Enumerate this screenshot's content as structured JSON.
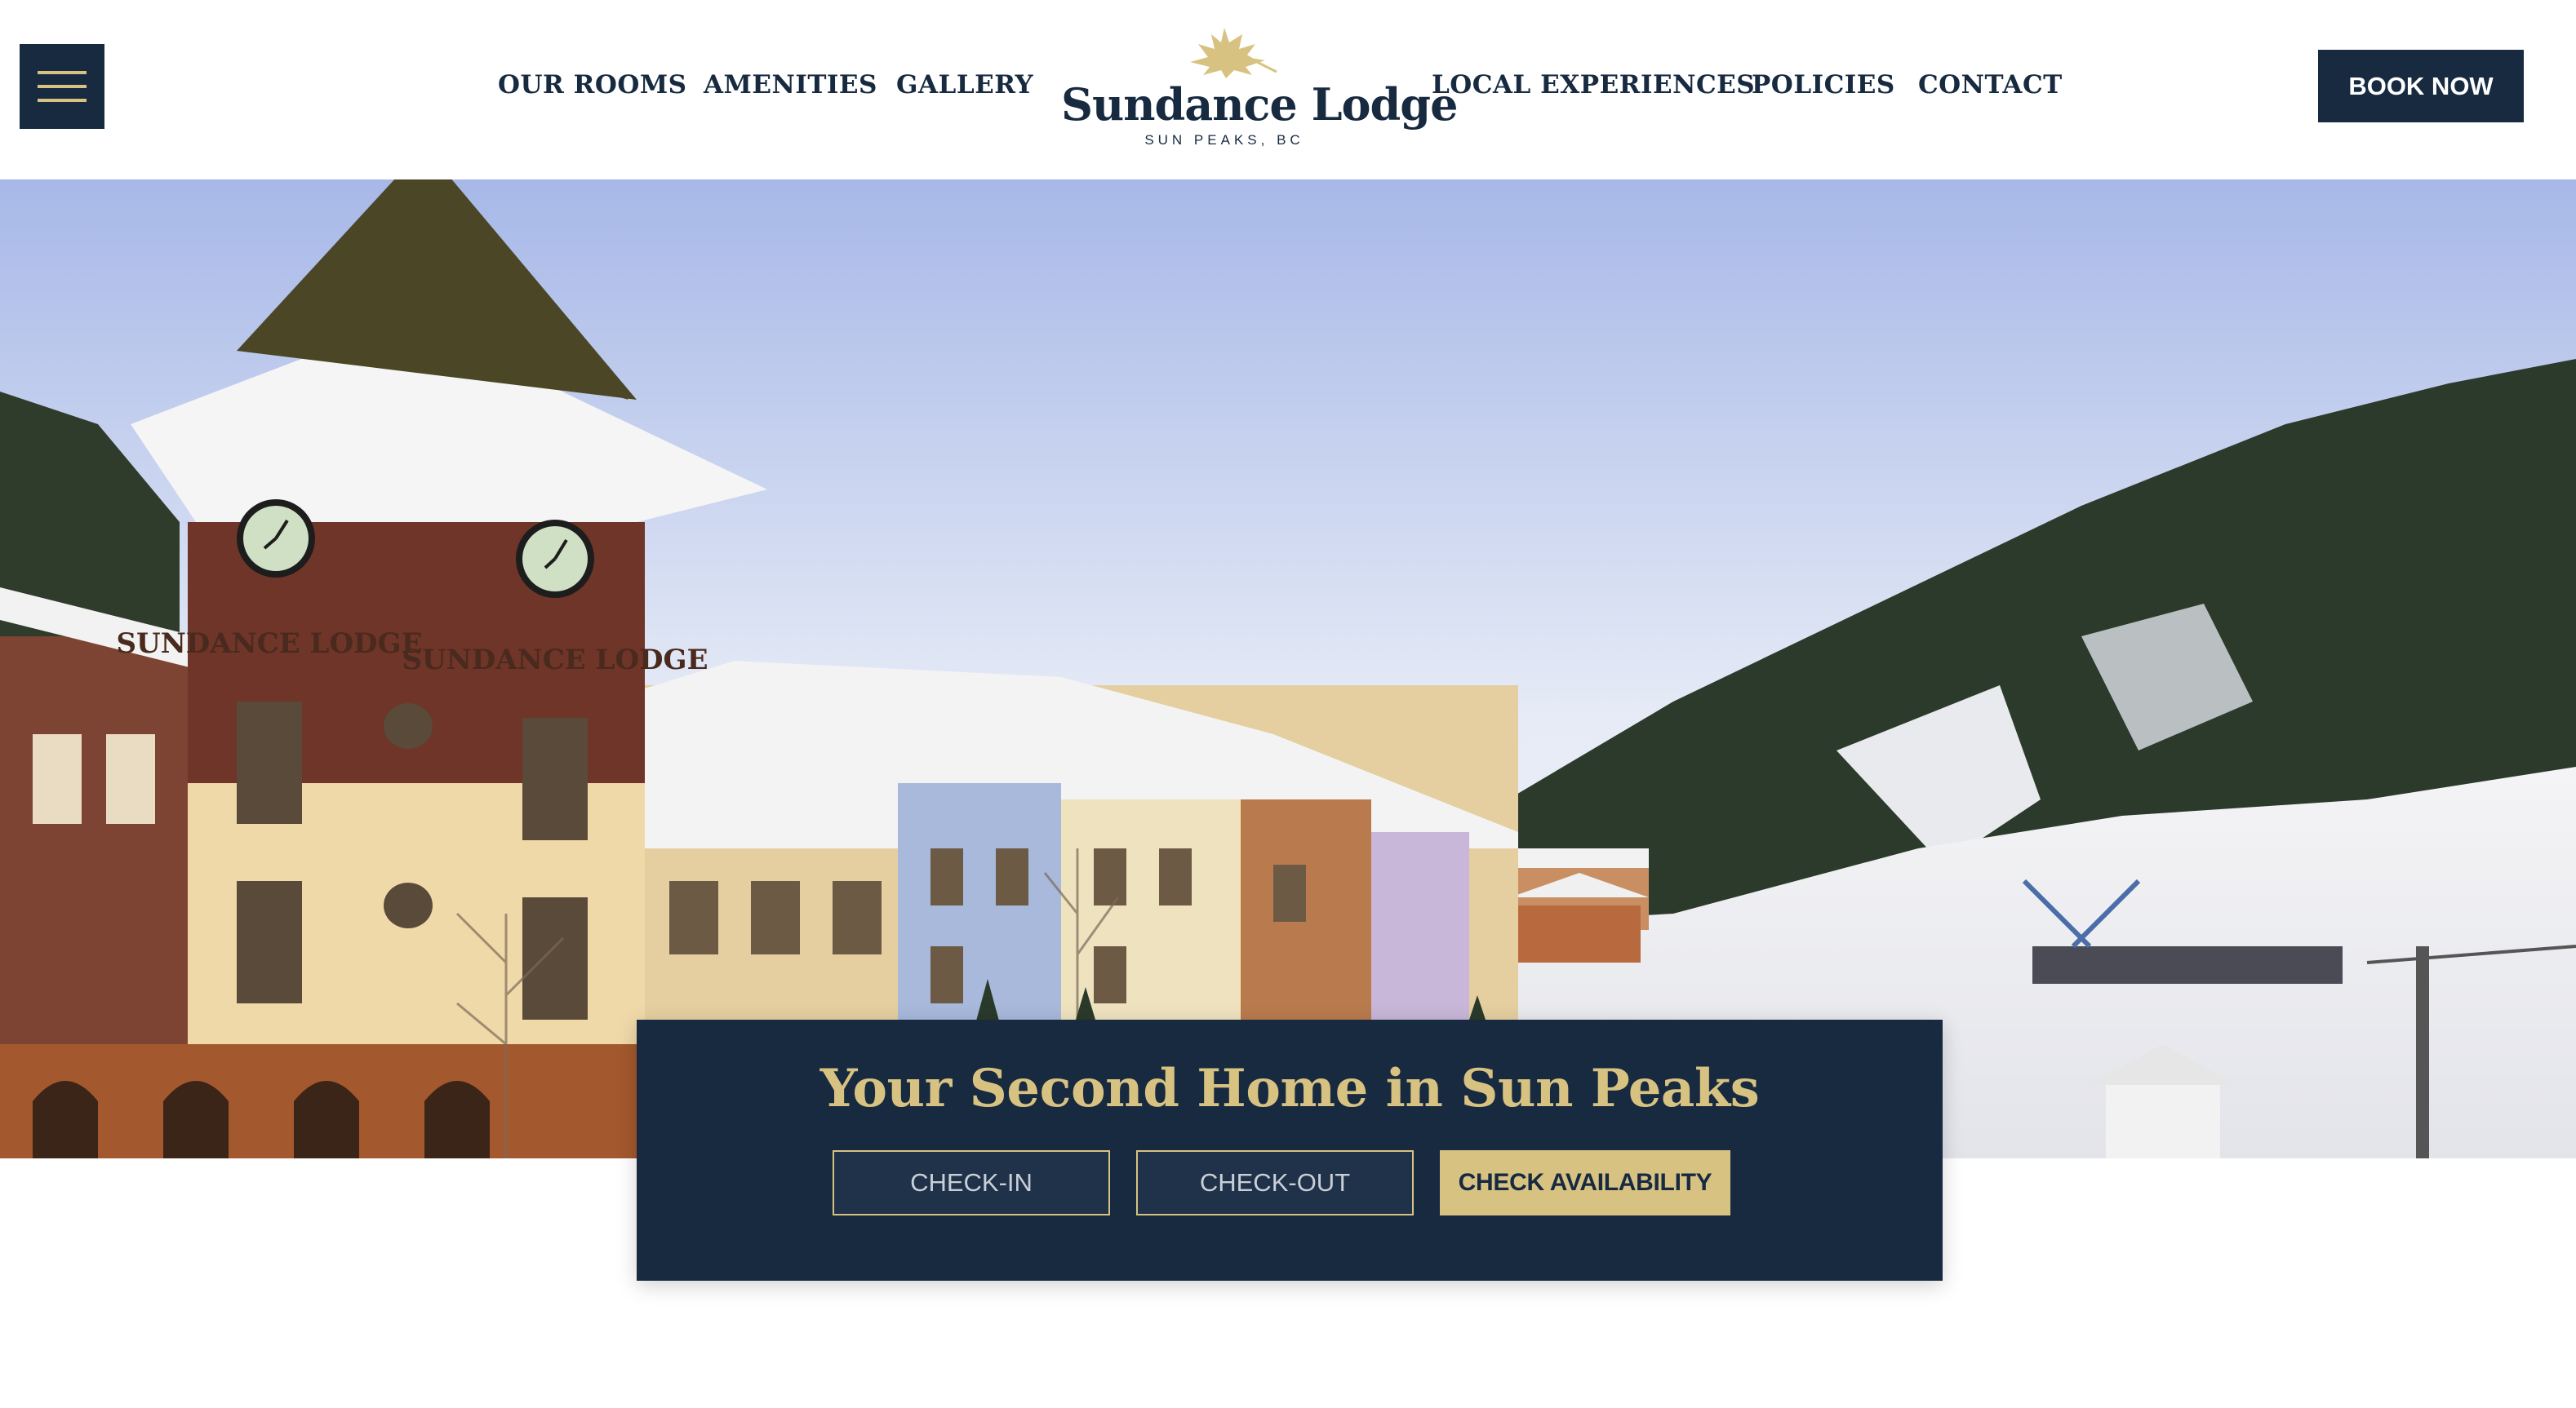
{
  "brand": {
    "name": "Sundance Lodge",
    "location": "SUN PEAKS, BC",
    "logo_icon": "maple-leaf-icon"
  },
  "nav": {
    "left": [
      "OUR ROOMS",
      "AMENITIES",
      "GALLERY"
    ],
    "right": [
      "LOCAL EXPERIENCES",
      "POLICIES",
      "CONTACT"
    ],
    "book_label": "BOOK NOW",
    "menu_icon": "hamburger-menu-icon"
  },
  "hero": {
    "image_subject": "ski-village-photo",
    "tower_sign_1": "SUNDANCE LODGE",
    "tower_sign_2": "SUNDANCE LODGE"
  },
  "booking": {
    "title": "Your Second Home in Sun Peaks",
    "checkin_placeholder": "CHECK-IN",
    "checkout_placeholder": "CHECK-OUT",
    "check_label": "CHECK AVAILABILITY"
  },
  "colors": {
    "navy": "#172a40",
    "gold": "#d7c282",
    "white": "#ffffff"
  }
}
